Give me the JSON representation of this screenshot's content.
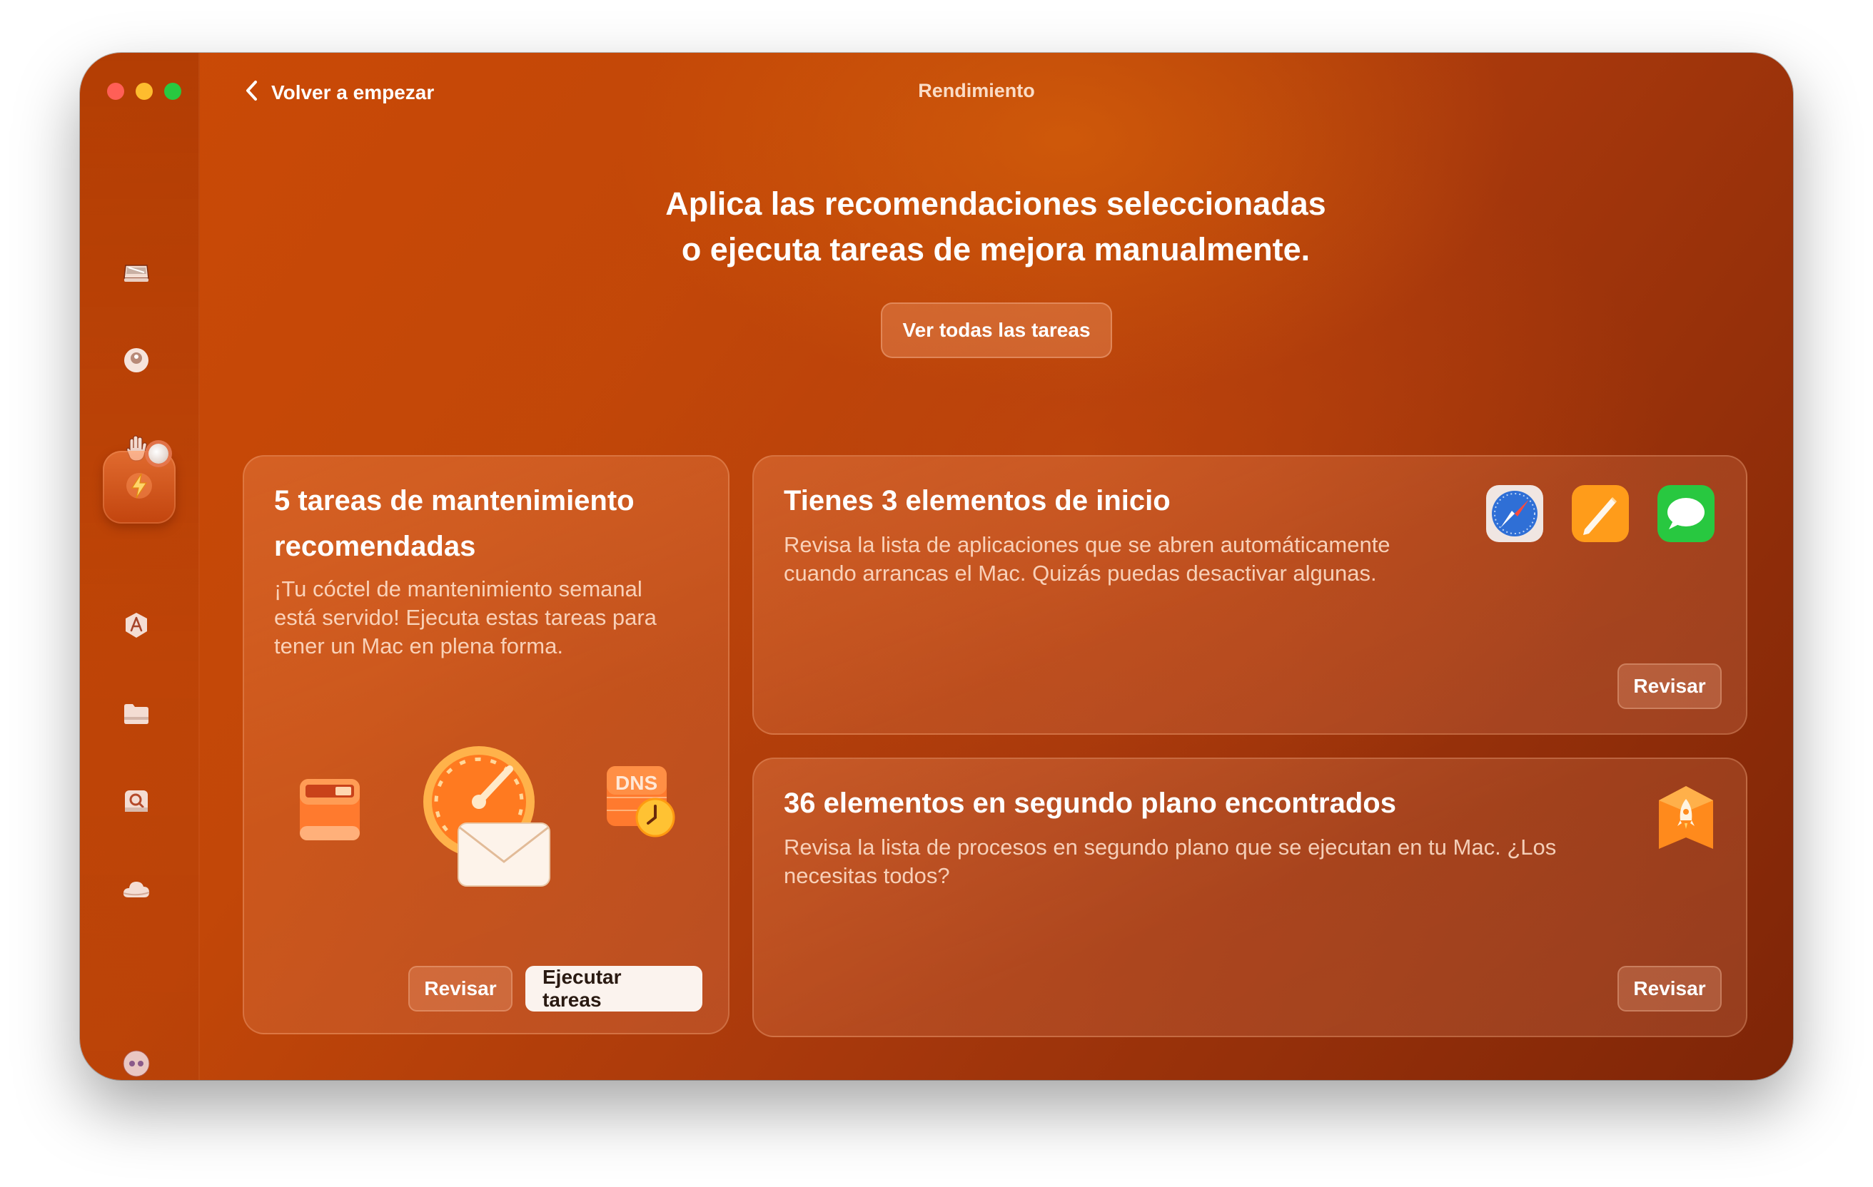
{
  "window": {
    "title": "Rendimiento",
    "back_label": "Volver a empezar"
  },
  "sidebar": {
    "items": [
      {
        "icon": "disk-icon"
      },
      {
        "icon": "shield-icon"
      },
      {
        "icon": "hand-icon"
      },
      {
        "icon": "lightning-icon",
        "active": true
      },
      {
        "icon": "app-store-icon"
      },
      {
        "icon": "folder-icon"
      },
      {
        "icon": "search-icon"
      },
      {
        "icon": "cloud-icon"
      }
    ],
    "bottom_icon": "assistant-icon"
  },
  "header": {
    "line1": "Aplica las recomendaciones seleccionadas",
    "line2": "o ejecuta tareas de mejora manualmente.",
    "view_all_label": "Ver todas las tareas"
  },
  "cards": {
    "maintenance": {
      "title_line1": "5 tareas de mantenimiento",
      "title_line2": "recomendadas",
      "desc_line1": "¡Tu cóctel de mantenimiento semanal",
      "desc_line2": "está servido! Ejecuta estas tareas para",
      "desc_line3": "tener un Mac en plena forma.",
      "dns_label": "DNS",
      "review_label": "Revisar",
      "run_label": "Ejecutar tareas"
    },
    "startup": {
      "title": "Tienes 3 elementos de inicio",
      "desc_line1": "Revisa la lista de aplicaciones que se abren automáticamente",
      "desc_line2": "cuando arrancas el Mac. Quizás puedas desactivar algunas.",
      "review_label": "Revisar",
      "apps": [
        "safari-icon",
        "pages-icon",
        "messages-icon"
      ]
    },
    "background": {
      "title": "36 elementos en segundo plano encontrados",
      "desc_line1": "Revisa la lista de procesos en segundo plano que se ejecutan en tu Mac. ¿Los",
      "desc_line2": "necesitas todos?",
      "review_label": "Revisar",
      "icon": "rocket-icon"
    }
  }
}
